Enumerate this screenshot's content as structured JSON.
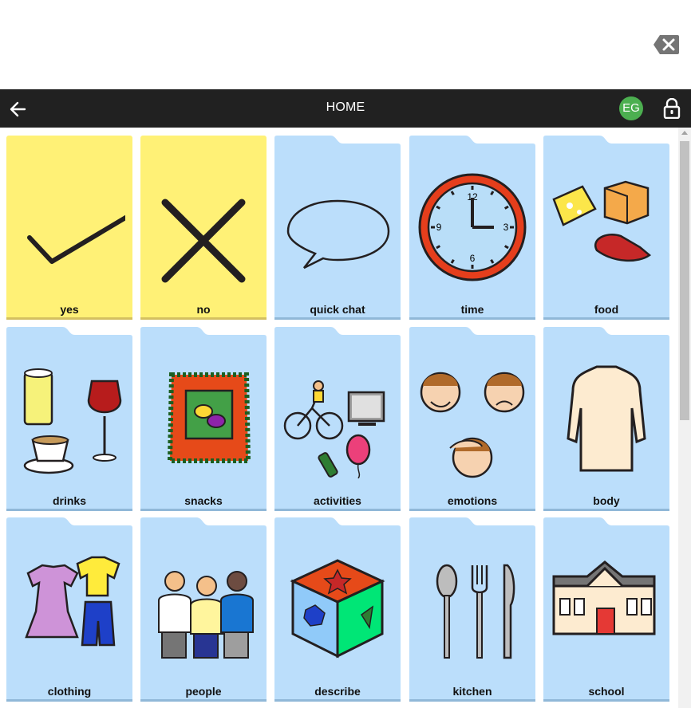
{
  "navbar": {
    "title": "HOME",
    "back_icon": "arrow-left-icon",
    "lock_icon": "lock-icon"
  },
  "user": {
    "initials": "EG",
    "color": "#4caf50"
  },
  "output_bar": {
    "backspace_icon": "backspace-icon"
  },
  "colors": {
    "yes_no_tile": "#fff176",
    "folder_tile": "#bbdefb",
    "navbar": "#212121"
  },
  "tiles": [
    {
      "label": "yes",
      "kind": "button",
      "icon": "checkmark-icon"
    },
    {
      "label": "no",
      "kind": "button",
      "icon": "cross-icon"
    },
    {
      "label": "quick chat",
      "kind": "folder",
      "icon": "speech-bubble-icon"
    },
    {
      "label": "time",
      "kind": "folder",
      "icon": "clock-icon"
    },
    {
      "label": "food",
      "kind": "folder",
      "icon": "food-icon"
    },
    {
      "label": "drinks",
      "kind": "folder",
      "icon": "drinks-icon"
    },
    {
      "label": "snacks",
      "kind": "folder",
      "icon": "snacks-icon"
    },
    {
      "label": "activities",
      "kind": "folder",
      "icon": "activities-icon"
    },
    {
      "label": "emotions",
      "kind": "folder",
      "icon": "emotions-icon"
    },
    {
      "label": "body",
      "kind": "folder",
      "icon": "body-icon"
    },
    {
      "label": "clothing",
      "kind": "folder",
      "icon": "clothing-icon"
    },
    {
      "label": "people",
      "kind": "folder",
      "icon": "people-icon"
    },
    {
      "label": "describe",
      "kind": "folder",
      "icon": "describe-cube-icon"
    },
    {
      "label": "kitchen",
      "kind": "folder",
      "icon": "cutlery-icon"
    },
    {
      "label": "school",
      "kind": "folder",
      "icon": "school-icon"
    }
  ],
  "clock": {
    "numerals": [
      "12",
      "3",
      "6",
      "9"
    ]
  }
}
